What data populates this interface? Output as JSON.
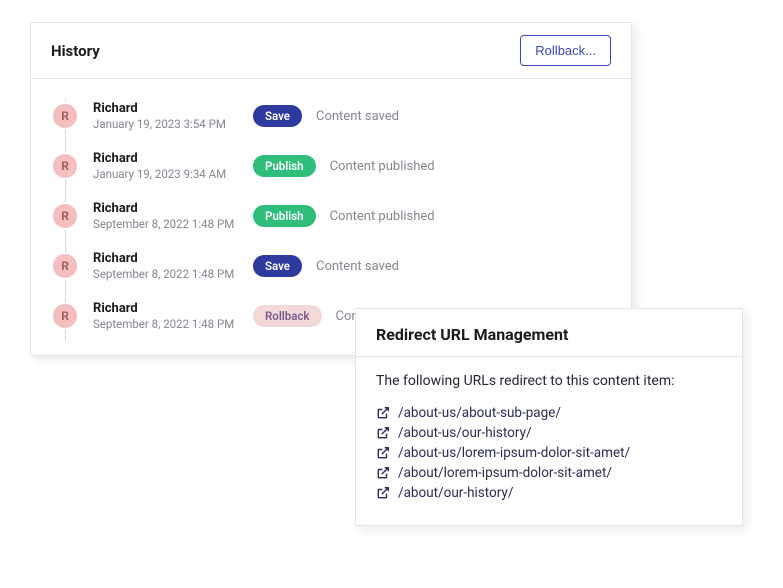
{
  "history": {
    "title": "History",
    "rollback_button": "Rollback...",
    "avatar_initial": "R",
    "entries": [
      {
        "name": "Richard",
        "date": "January 19, 2023 3:54 PM",
        "badge_key": "Save",
        "badge_class": "save",
        "message": "Content saved"
      },
      {
        "name": "Richard",
        "date": "January 19, 2023 9:34 AM",
        "badge_key": "Publish",
        "badge_class": "publish",
        "message": "Content published"
      },
      {
        "name": "Richard",
        "date": "September 8, 2022 1:48 PM",
        "badge_key": "Publish",
        "badge_class": "publish",
        "message": "Content published"
      },
      {
        "name": "Richard",
        "date": "September 8, 2022 1:48 PM",
        "badge_key": "Save",
        "badge_class": "save",
        "message": "Content saved"
      },
      {
        "name": "Richard",
        "date": "September 8, 2022 1:48 PM",
        "badge_key": "Rollback",
        "badge_class": "rollback",
        "message": "Conten"
      }
    ]
  },
  "redirect": {
    "title": "Redirect URL Management",
    "intro": "The following URLs redirect to this content item:",
    "urls": [
      "/about-us/about-sub-page/",
      "/about-us/our-history/",
      "/about-us/lorem-ipsum-dolor-sit-amet/",
      "/about/lorem-ipsum-dolor-sit-amet/",
      "/about/our-history/"
    ]
  }
}
